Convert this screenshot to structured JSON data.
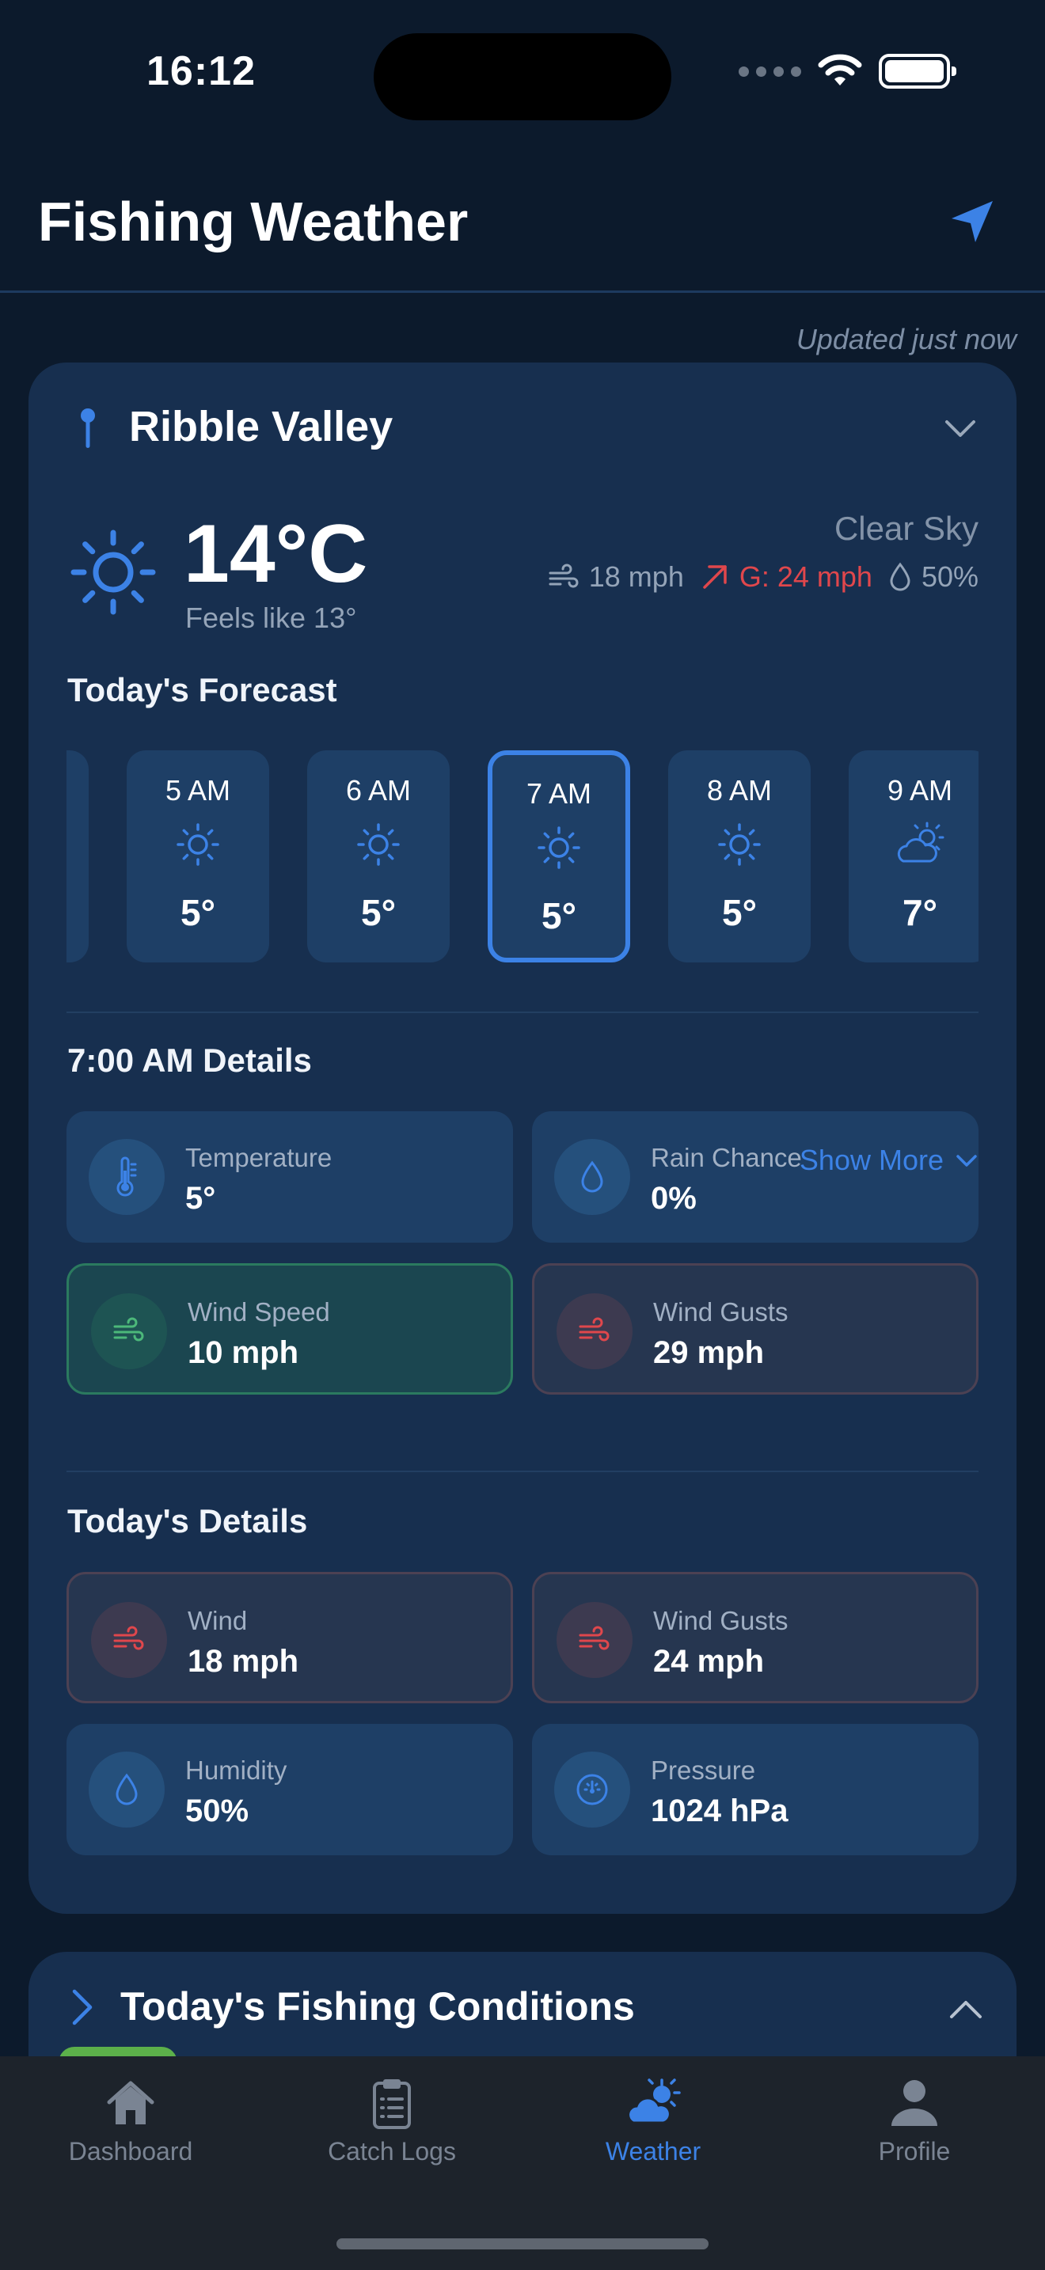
{
  "status_bar": {
    "time": "16:12"
  },
  "header": {
    "title": "Fishing Weather"
  },
  "updated": "Updated just now",
  "location": {
    "name": "Ribble Valley"
  },
  "current": {
    "temp": "14°C",
    "feels_like": "Feels like 13°",
    "sky": "Clear Sky",
    "wind": "18 mph",
    "gust": "G: 24 mph",
    "humidity": "50%"
  },
  "forecast": {
    "title": "Today's Forecast",
    "hours": [
      {
        "label": "5 AM",
        "icon": "sun-icon",
        "temp": "5°"
      },
      {
        "label": "6 AM",
        "icon": "sun-icon",
        "temp": "5°"
      },
      {
        "label": "7 AM",
        "icon": "sun-icon",
        "temp": "5°",
        "selected": true
      },
      {
        "label": "8 AM",
        "icon": "sun-icon",
        "temp": "5°"
      },
      {
        "label": "9 AM",
        "icon": "partly-cloudy-icon",
        "temp": "7°"
      }
    ]
  },
  "hour_details": {
    "title": "7:00 AM Details",
    "tiles": [
      {
        "label": "Temperature",
        "value": "5°",
        "icon": "thermometer-icon"
      },
      {
        "label": "Rain Chance",
        "value": "0%",
        "icon": "droplet-icon"
      },
      {
        "label": "Wind Speed",
        "value": "10 mph",
        "icon": "wind-icon"
      },
      {
        "label": "Wind Gusts",
        "value": "29 mph",
        "icon": "wind-icon"
      }
    ]
  },
  "today_details": {
    "title": "Today's Details",
    "show_more": "Show More",
    "tiles": [
      {
        "label": "Wind",
        "value": "18 mph",
        "icon": "wind-icon"
      },
      {
        "label": "Wind Gusts",
        "value": "24 mph",
        "icon": "wind-icon"
      },
      {
        "label": "Humidity",
        "value": "50%",
        "icon": "droplet-icon"
      },
      {
        "label": "Pressure",
        "value": "1024 hPa",
        "icon": "gauge-icon"
      }
    ]
  },
  "fishing": {
    "title": "Today's Fishing Conditions"
  },
  "tabs": [
    {
      "label": "Dashboard",
      "icon": "home-icon"
    },
    {
      "label": "Catch Logs",
      "icon": "clipboard-icon"
    },
    {
      "label": "Weather",
      "icon": "weather-icon",
      "active": true
    },
    {
      "label": "Profile",
      "icon": "person-icon"
    }
  ],
  "colors": {
    "accent": "#3c82e6",
    "background": "#0c1a2c",
    "card": "#172f4f",
    "tile": "#1e3f66",
    "gust_red": "#e0474c",
    "wind_green": "#4cb87a"
  }
}
